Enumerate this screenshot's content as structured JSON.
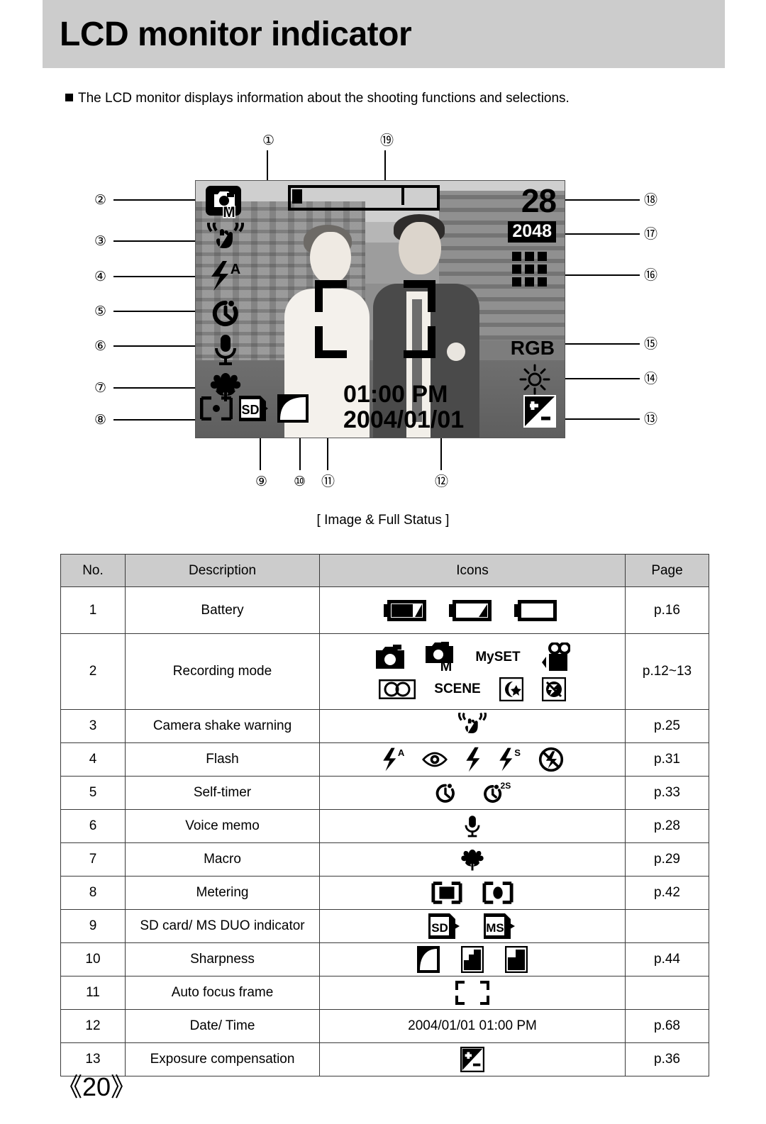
{
  "header": {
    "title": "LCD monitor indicator"
  },
  "intro": {
    "text": "The LCD monitor displays information about the shooting functions and selections."
  },
  "figure": {
    "caption": "[ Image & Full Status ]",
    "lcd": {
      "frames_remaining": "28",
      "resolution": "2048",
      "color_effect": "RGB",
      "time": "01:00 PM",
      "date": "2004/01/01",
      "recording_mode_letter": "M"
    },
    "callouts": [
      {
        "id": "1",
        "label": "①"
      },
      {
        "id": "2",
        "label": "②"
      },
      {
        "id": "3",
        "label": "③"
      },
      {
        "id": "4",
        "label": "④"
      },
      {
        "id": "5",
        "label": "⑤"
      },
      {
        "id": "6",
        "label": "⑥"
      },
      {
        "id": "7",
        "label": "⑦"
      },
      {
        "id": "8",
        "label": "⑧"
      },
      {
        "id": "9",
        "label": "⑨"
      },
      {
        "id": "10",
        "label": "⑩"
      },
      {
        "id": "11",
        "label": "⑪"
      },
      {
        "id": "12",
        "label": "⑫"
      },
      {
        "id": "13",
        "label": "⑬"
      },
      {
        "id": "14",
        "label": "⑭"
      },
      {
        "id": "15",
        "label": "⑮"
      },
      {
        "id": "16",
        "label": "⑯"
      },
      {
        "id": "17",
        "label": "⑰"
      },
      {
        "id": "18",
        "label": "⑱"
      },
      {
        "id": "19",
        "label": "⑲"
      }
    ]
  },
  "table": {
    "columns": [
      "No.",
      "Description",
      "Icons",
      "Page"
    ],
    "rows": [
      {
        "no": "1",
        "description": "Battery",
        "icons": [
          "battery-full-icon",
          "battery-half-icon",
          "battery-empty-icon"
        ],
        "page": "p.16"
      },
      {
        "no": "2",
        "description": "Recording mode",
        "icons": [
          "camera-auto-icon",
          "camera-manual-icon",
          "myset-label",
          "movie-clip-icon",
          "voice-recording-icon",
          "scene-label",
          "night-scene-icon",
          "no-flash-scene-icon"
        ],
        "page": "p.12~13",
        "labels": [
          "MySET",
          "SCENE"
        ]
      },
      {
        "no": "3",
        "description": "Camera shake warning",
        "icons": [
          "camera-shake-icon"
        ],
        "page": "p.25"
      },
      {
        "no": "4",
        "description": "Flash",
        "icons": [
          "flash-auto-icon",
          "red-eye-icon",
          "fill-flash-icon",
          "slow-sync-icon",
          "flash-off-icon"
        ],
        "page": "p.31"
      },
      {
        "no": "5",
        "description": "Self-timer",
        "icons": [
          "self-timer-10s-icon",
          "self-timer-2s-icon"
        ],
        "page": "p.33"
      },
      {
        "no": "6",
        "description": "Voice memo",
        "icons": [
          "microphone-icon"
        ],
        "page": "p.28"
      },
      {
        "no": "7",
        "description": "Macro",
        "icons": [
          "macro-flower-icon"
        ],
        "page": "p.29"
      },
      {
        "no": "8",
        "description": "Metering",
        "icons": [
          "metering-multi-icon",
          "metering-spot-icon"
        ],
        "page": "p.42"
      },
      {
        "no": "9",
        "description": "SD card/ MS DUO indicator",
        "icons": [
          "sd-card-icon",
          "ms-duo-icon"
        ],
        "page": ""
      },
      {
        "no": "10",
        "description": "Sharpness",
        "icons": [
          "sharpness-soft-icon",
          "sharpness-normal-icon",
          "sharpness-vivid-icon"
        ],
        "page": "p.44"
      },
      {
        "no": "11",
        "description": "Auto focus frame",
        "icons": [
          "auto-focus-frame-icon"
        ],
        "page": ""
      },
      {
        "no": "12",
        "description": "Date/ Time",
        "text": "2004/01/01   01:00 PM",
        "page": "p.68"
      },
      {
        "no": "13",
        "description": "Exposure compensation",
        "icons": [
          "exposure-compensation-icon"
        ],
        "page": "p.36"
      }
    ]
  },
  "footer": {
    "page_number": "《20》"
  }
}
